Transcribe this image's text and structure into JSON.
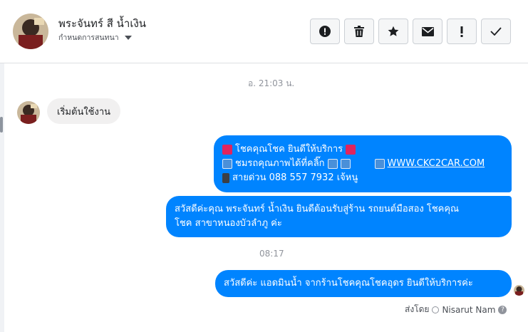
{
  "header": {
    "contact_name": "พระจันทร์ สี น้ำเงิน",
    "convo_settings_label": "กำหนดการสนทนา",
    "actions": [
      {
        "name": "report-button",
        "icon": "exclamation-circle-icon"
      },
      {
        "name": "delete-button",
        "icon": "trash-icon"
      },
      {
        "name": "star-button",
        "icon": "star-icon"
      },
      {
        "name": "mark-unread-button",
        "icon": "envelope-icon"
      },
      {
        "name": "spam-button",
        "icon": "exclamation-icon"
      },
      {
        "name": "mark-done-button",
        "icon": "checkmark-icon"
      }
    ]
  },
  "thread": {
    "timestamp_1": "อ. 21:03 น.",
    "incoming_message": "เริ่มต้นใช้งาน",
    "outgoing_1": {
      "line1_text": "โชคคุณโชค ยินดีให้บริการ",
      "line2_text": "ชมรถคุณภาพได้ที่คลิ๊ก",
      "line2_link": "WWW.CKC2CAR.COM",
      "line3_text": "สายด่วน 088 557 7932 เจ้หนู"
    },
    "outgoing_2_line1": "สวัสดีค่ะคุณ พระจันทร์ น้ำเงิน ยินดีต้อนรับสู่ร้าน รถยนต์มือสอง โชคคุณ",
    "outgoing_2_line2": "โชค สาขาหนองบัวลำภู ค่ะ",
    "timestamp_2": "08:17",
    "outgoing_3": "สวัสดีค่ะ แอดมินน้ำ จากร้านโชคคุณโชคอุดร ยินดีให้บริการค่ะ",
    "sent_by_label": "ส่งโดย",
    "sent_by_name": "Nisarut Nam"
  },
  "colors": {
    "accent": "#0084ff",
    "incoming_bubble": "#f1f0f0"
  }
}
